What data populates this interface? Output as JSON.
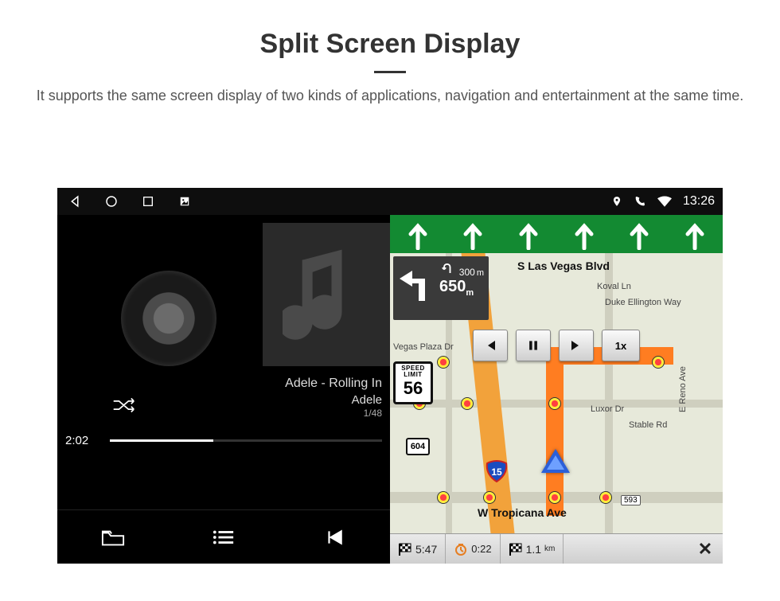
{
  "hero": {
    "title": "Split Screen Display",
    "subtitle": "It supports the same screen display of two kinds of applications, navigation and entertainment at the same time."
  },
  "statusbar": {
    "clock": "13:26"
  },
  "player": {
    "track_title": "Adele - Rolling In",
    "artist": "Adele",
    "index": "1/48",
    "time": "2:02"
  },
  "nav": {
    "turn": {
      "next_distance_value": "300",
      "next_distance_unit": "m",
      "primary_distance_value": "650",
      "primary_distance_unit": "m"
    },
    "speed_limit": {
      "label_top": "SPEED",
      "label_mid": "LIMIT",
      "value": "56"
    },
    "media_speed": "1x",
    "streets": {
      "s_las_vegas": "S Las Vegas Blvd",
      "koval": "Koval Ln",
      "duke": "Duke Ellington Way",
      "vegas_plaza": "Vegas Plaza Dr",
      "luxor": "Luxor Dr",
      "stable": "Stable Rd",
      "reno": "E Reno Ave",
      "tropicana": "W Tropicana Ave"
    },
    "shields": {
      "sr604": "604",
      "i15": "15",
      "exit593": "593"
    },
    "bottombar": {
      "eta": "5:47",
      "duration": "0:22",
      "distance": "1.1",
      "distance_unit": "km"
    }
  }
}
